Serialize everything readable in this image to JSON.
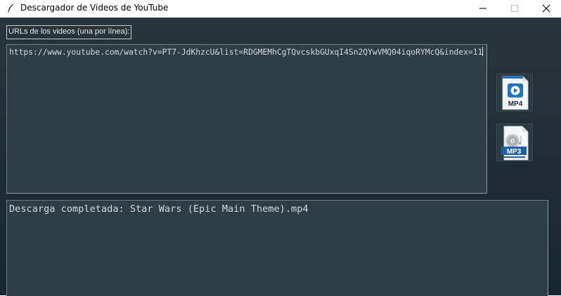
{
  "window": {
    "title": "Descargador de Videos de YouTube",
    "icon": "feather-icon"
  },
  "urls_section": {
    "label": "URLs de los videos (una por línea):",
    "value": "https://www.youtube.com/watch?v=PT7-JdKhzcU&list=RDGMEMhCgTQvcskbGUxqI4Sn2QYwVMQ04iqoRYMcQ&index=11"
  },
  "buttons": {
    "mp4": {
      "label": "MP4",
      "icon": "mp4-file-icon",
      "accent": "#1a73c8"
    },
    "mp3": {
      "label": "MP3",
      "icon": "mp3-file-icon",
      "accent": "#1e5fa8"
    }
  },
  "log": {
    "text": "Descarga completada: Star Wars (Epic Main Theme).mp4"
  },
  "colors": {
    "background_top": "#2a353b",
    "background_bottom": "#182632",
    "textbox_bg": "#2f3e44",
    "text": "#d4d8da"
  }
}
